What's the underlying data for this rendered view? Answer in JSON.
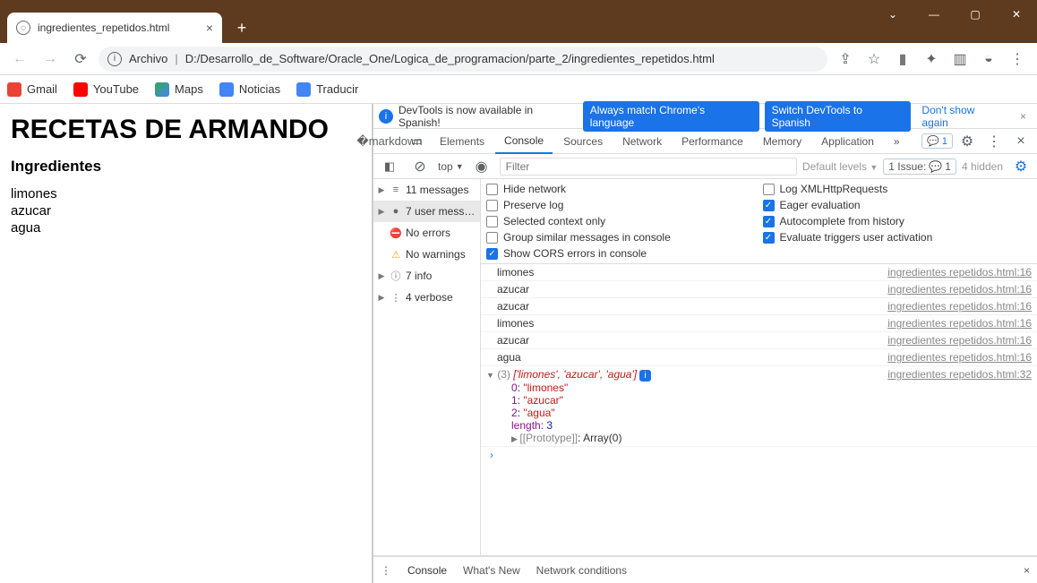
{
  "window": {
    "tab_title": "ingredientes_repetidos.html"
  },
  "addr": {
    "label": "Archivo",
    "path": "D:/Desarrollo_de_Software/Oracle_One/Logica_de_programacion/parte_2/ingredientes_repetidos.html"
  },
  "bookmarks": [
    {
      "label": "Gmail"
    },
    {
      "label": "YouTube"
    },
    {
      "label": "Maps"
    },
    {
      "label": "Noticias"
    },
    {
      "label": "Traducir"
    }
  ],
  "page": {
    "h1": "RECETAS DE ARMANDO",
    "h3": "Ingredientes",
    "items": [
      "limones",
      "azucar",
      "agua"
    ]
  },
  "banner": {
    "msg": "DevTools is now available in Spanish!",
    "btn1": "Always match Chrome's language",
    "btn2": "Switch DevTools to Spanish",
    "link": "Don't show again"
  },
  "dtabs": [
    "Elements",
    "Console",
    "Sources",
    "Network",
    "Performance",
    "Memory",
    "Application"
  ],
  "dtabs_active": 1,
  "issue_count": "1",
  "filter": {
    "top": "top",
    "placeholder": "Filter",
    "levels": "Default levels",
    "issues_label": "1 Issue:",
    "issues_n": "1",
    "hidden": "4 hidden"
  },
  "sidebar": [
    {
      "tri": "▶",
      "icon": "list",
      "label": "11 messages",
      "sel": false
    },
    {
      "tri": "▶",
      "icon": "user",
      "label": "7 user mess…",
      "sel": true
    },
    {
      "tri": "",
      "icon": "err",
      "label": "No errors",
      "sel": false
    },
    {
      "tri": "",
      "icon": "warn",
      "label": "No warnings",
      "sel": false
    },
    {
      "tri": "▶",
      "icon": "info",
      "label": "7 info",
      "sel": false
    },
    {
      "tri": "▶",
      "icon": "verb",
      "label": "4 verbose",
      "sel": false
    }
  ],
  "settings": [
    {
      "on": false,
      "label": "Hide network"
    },
    {
      "on": false,
      "label": "Log XMLHttpRequests"
    },
    {
      "on": false,
      "label": "Preserve log"
    },
    {
      "on": true,
      "label": "Eager evaluation"
    },
    {
      "on": false,
      "label": "Selected context only"
    },
    {
      "on": true,
      "label": "Autocomplete from history"
    },
    {
      "on": false,
      "label": "Group similar messages in console"
    },
    {
      "on": true,
      "label": "Evaluate triggers user activation"
    },
    {
      "on": true,
      "label": "Show CORS errors in console"
    }
  ],
  "logs": [
    {
      "text": "limones",
      "src": "ingredientes repetidos.html:16"
    },
    {
      "text": "azucar",
      "src": "ingredientes repetidos.html:16"
    },
    {
      "text": "azucar",
      "src": "ingredientes repetidos.html:16"
    },
    {
      "text": "limones",
      "src": "ingredientes repetidos.html:16"
    },
    {
      "text": "azucar",
      "src": "ingredientes repetidos.html:16"
    },
    {
      "text": "agua",
      "src": "ingredientes repetidos.html:16"
    }
  ],
  "array_log": {
    "src": "ingredientes repetidos.html:32",
    "count": "(3)",
    "preview": "['limones', 'azucar', 'agua']",
    "items": [
      {
        "k": "0",
        "v": "\"limones\""
      },
      {
        "k": "1",
        "v": "\"azucar\""
      },
      {
        "k": "2",
        "v": "\"agua\""
      }
    ],
    "length_k": "length",
    "length_v": "3",
    "proto": "[[Prototype]]",
    "proto_v": "Array(0)"
  },
  "drawer": [
    "Console",
    "What's New",
    "Network conditions"
  ]
}
